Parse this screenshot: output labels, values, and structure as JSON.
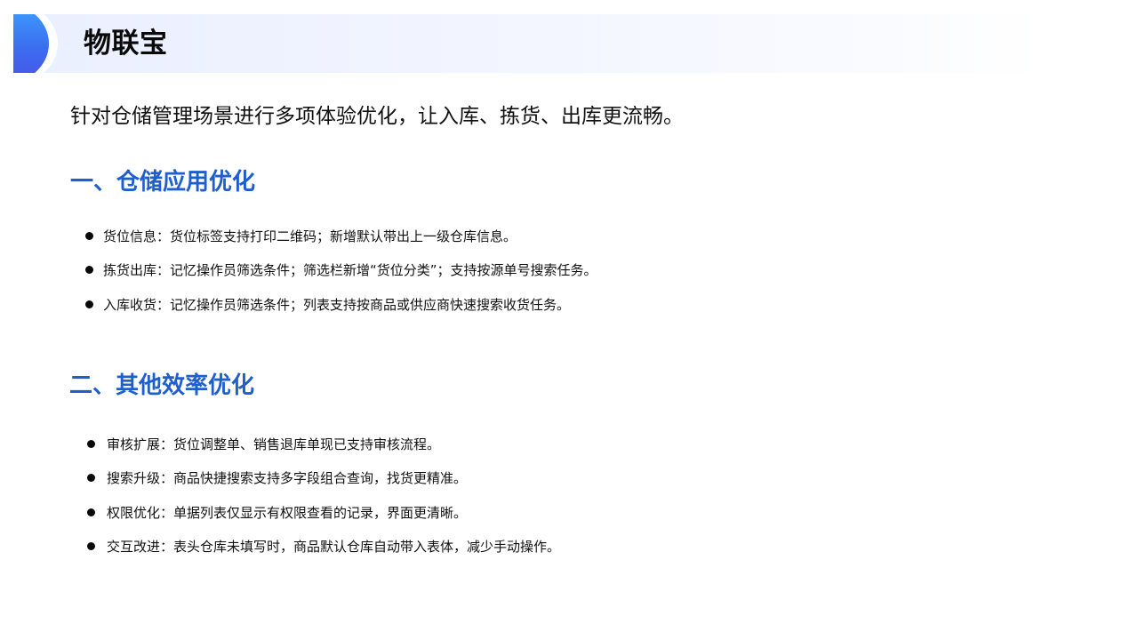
{
  "header": {
    "title": "物联宝"
  },
  "intro": "针对仓储管理场景进行多项体验优化，让入库、拣货、出库更流畅。",
  "sections": [
    {
      "title": "一、仓储应用优化",
      "items": [
        "货位信息：货位标签支持打印二维码；新增默认带出上一级仓库信息。",
        "拣货出库：记忆操作员筛选条件；筛选栏新增“货位分类”；支持按源单号搜索任务。",
        "入库收货：记忆操作员筛选条件；列表支持按商品或供应商快速搜索收货任务。"
      ]
    },
    {
      "title": "二、其他效率优化",
      "items": [
        "审核扩展：货位调整单、销售退库单现已支持审核流程。",
        "搜索升级：商品快捷搜索支持多字段组合查询，找货更精准。",
        "权限优化：单据列表仅显示有权限查看的记录，界面更清晰。",
        "交互改进：表头仓库未填写时，商品默认仓库自动带入表体，减少手动操作。"
      ]
    }
  ],
  "colors": {
    "section_title": "#1f5fcc",
    "accent_top": "#3ea0ff",
    "accent_bottom": "#4a52e6",
    "header_band": "#eaefff"
  }
}
